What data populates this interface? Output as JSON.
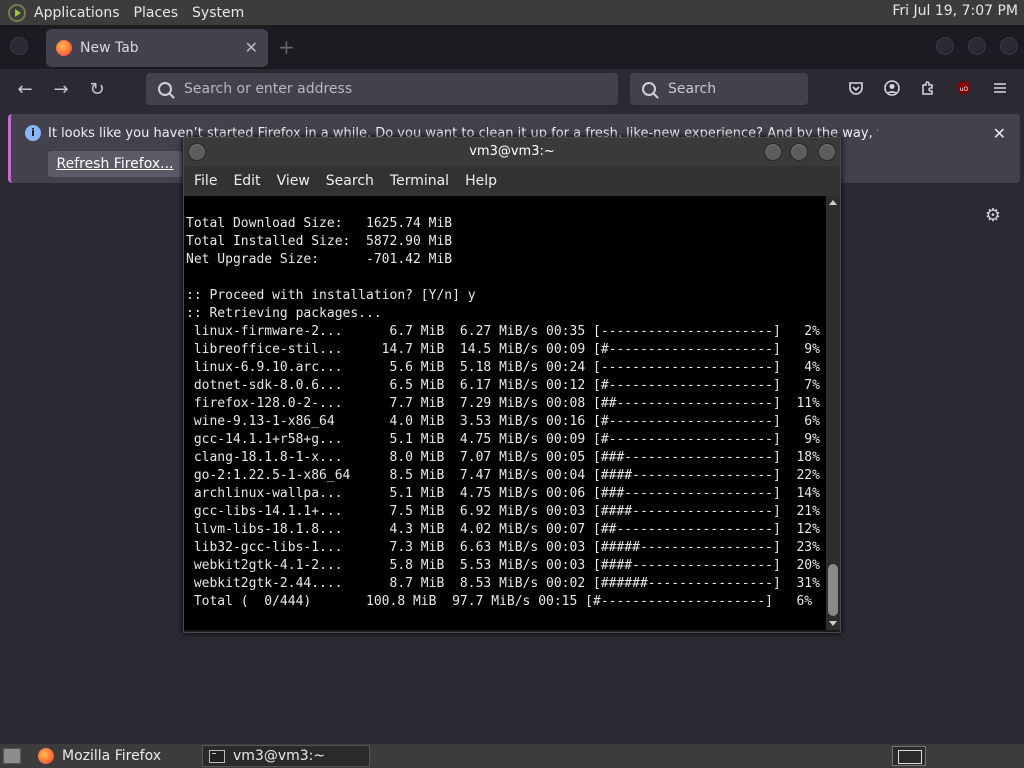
{
  "top_panel": {
    "menus": [
      "Applications",
      "Places",
      "System"
    ],
    "clock": "Fri Jul 19,  7:07 PM"
  },
  "firefox": {
    "tab_title": "New Tab",
    "tab_close": "✕",
    "new_tab": "+",
    "url_placeholder": "Search or enter address",
    "search_placeholder": "Search",
    "nav": {
      "back": "←",
      "forward": "→",
      "reload": "↻"
    },
    "toolbar_icons": [
      "pocket-icon",
      "account-icon",
      "extensions-icon",
      "ublock-icon",
      "menu-icon"
    ],
    "notification": {
      "message": "It looks like you haven’t started Firefox in a while. Do you want to clean it up for a fresh, like-new experience? And by the way, welcome back!",
      "button": "Refresh Firefox...",
      "close": "✕"
    }
  },
  "terminal": {
    "title": "vm3@vm3:~",
    "menu": [
      "File",
      "Edit",
      "View",
      "Search",
      "Terminal",
      "Help"
    ],
    "lines": [
      "Total Download Size:   1625.74 MiB",
      "Total Installed Size:  5872.90 MiB",
      "Net Upgrade Size:      -701.42 MiB",
      "",
      ":: Proceed with installation? [Y/n] y",
      ":: Retrieving packages...",
      " linux-firmware-2...      6.7 MiB  6.27 MiB/s 00:35 [----------------------]   2%",
      " libreoffice-stil...     14.7 MiB  14.5 MiB/s 00:09 [#---------------------]   9%",
      " linux-6.9.10.arc...      5.6 MiB  5.18 MiB/s 00:24 [----------------------]   4%",
      " dotnet-sdk-8.0.6...      6.5 MiB  6.17 MiB/s 00:12 [#---------------------]   7%",
      " firefox-128.0-2-...      7.7 MiB  7.29 MiB/s 00:08 [##--------------------]  11%",
      " wine-9.13-1-x86_64       4.0 MiB  3.53 MiB/s 00:16 [#---------------------]   6%",
      " gcc-14.1.1+r58+g...      5.1 MiB  4.75 MiB/s 00:09 [#---------------------]   9%",
      " clang-18.1.8-1-x...      8.0 MiB  7.07 MiB/s 00:05 [###-------------------]  18%",
      " go-2:1.22.5-1-x86_64     8.5 MiB  7.47 MiB/s 00:04 [####------------------]  22%",
      " archlinux-wallpa...      5.1 MiB  4.75 MiB/s 00:06 [###-------------------]  14%",
      " gcc-libs-14.1.1+...      7.5 MiB  6.92 MiB/s 00:03 [####------------------]  21%",
      " llvm-libs-18.1.8...      4.3 MiB  4.02 MiB/s 00:07 [##--------------------]  12%",
      " lib32-gcc-libs-1...      7.3 MiB  6.63 MiB/s 00:03 [#####-----------------]  23%",
      " webkit2gtk-4.1-2...      5.8 MiB  5.53 MiB/s 00:03 [####------------------]  20%",
      " webkit2gtk-2.44....      8.7 MiB  8.53 MiB/s 00:02 [######----------------]  31%",
      " Total (  0/444)       100.8 MiB  97.7 MiB/s 00:15 [#---------------------]   6%"
    ]
  },
  "taskbar": {
    "tasks": [
      "Mozilla Firefox",
      "vm3@vm3:~"
    ]
  }
}
